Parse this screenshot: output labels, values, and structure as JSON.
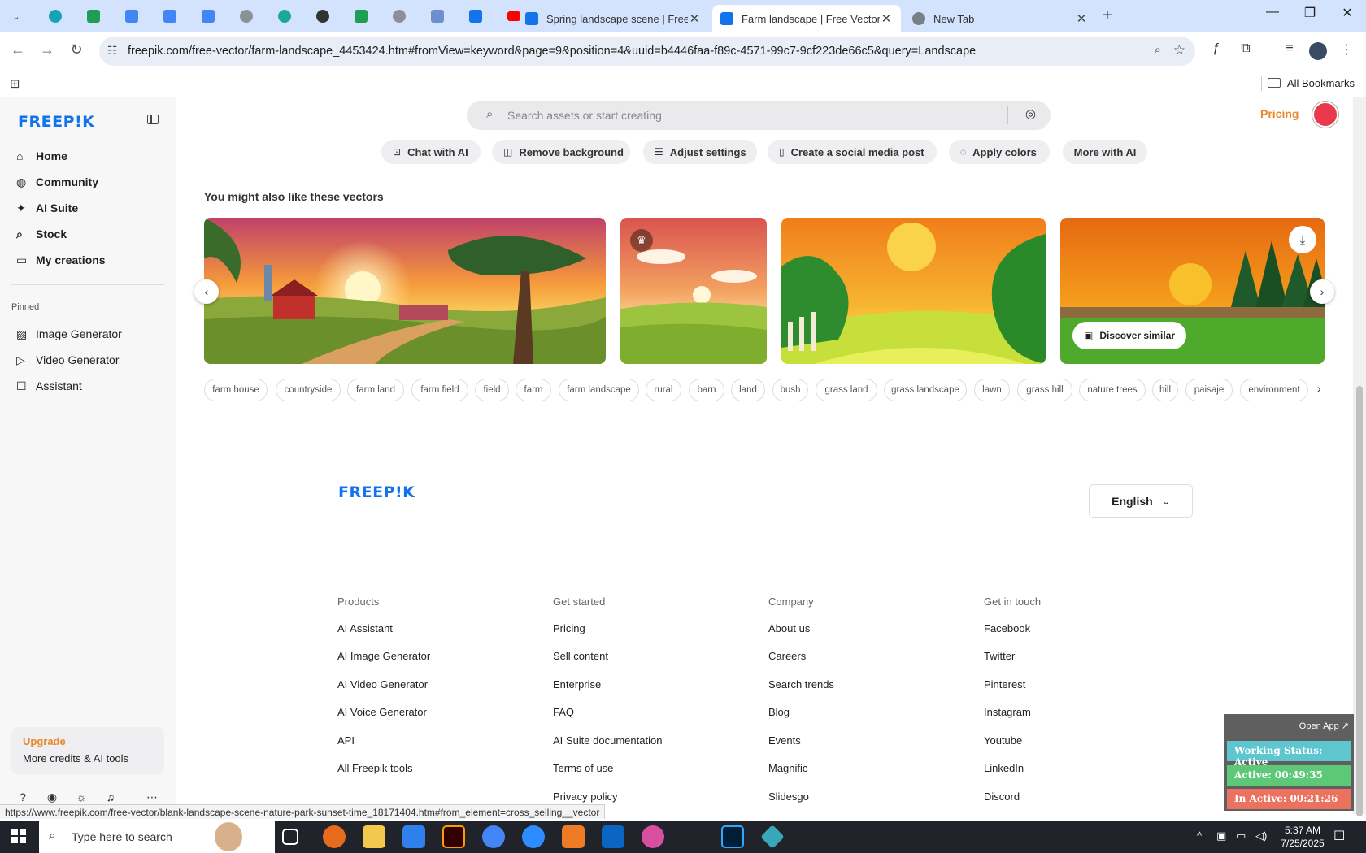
{
  "browser": {
    "tabs": [
      {
        "title": "Spring landscape scene | Free V",
        "favicon": "freepik-icon",
        "active": false
      },
      {
        "title": "Farm landscape | Free Vector",
        "favicon": "freepik-icon",
        "active": true
      },
      {
        "title": "New Tab",
        "favicon": "chrome-icon",
        "active": false
      }
    ],
    "url": "freepik.com/free-vector/farm-landscape_4453424.htm#fromView=keyword&page=9&position=4&uuid=b4446faa-f89c-4571-99c7-9cf223de66c5&query=Landscape",
    "bookmarks_label": "All Bookmarks",
    "status_url": "https://www.freepik.com/free-vector/blank-landscape-scene-nature-park-sunset-time_18171404.htm#from_element=cross_selling__vector"
  },
  "sidebar": {
    "logo": "FREEP!K",
    "nav": [
      {
        "label": "Home",
        "icon": "home-icon"
      },
      {
        "label": "Community",
        "icon": "globe-icon"
      },
      {
        "label": "AI Suite",
        "icon": "sparkle-icon"
      },
      {
        "label": "Stock",
        "icon": "search-icon"
      },
      {
        "label": "My creations",
        "icon": "folder-icon"
      }
    ],
    "pinned_label": "Pinned",
    "pinned": [
      {
        "label": "Image Generator",
        "icon": "image-icon"
      },
      {
        "label": "Video Generator",
        "icon": "video-icon"
      },
      {
        "label": "Assistant",
        "icon": "chat-icon"
      }
    ],
    "upgrade_title": "Upgrade",
    "upgrade_sub": "More credits & AI tools"
  },
  "header": {
    "search_placeholder": "Search assets or start creating",
    "pricing": "Pricing"
  },
  "ai_chips": [
    {
      "label": "Chat with AI",
      "icon": "chat-icon"
    },
    {
      "label": "Remove background",
      "icon": "eraser-icon"
    },
    {
      "label": "Adjust settings",
      "icon": "sliders-icon"
    },
    {
      "label": "Create a social media post",
      "icon": "phone-icon"
    },
    {
      "label": "Apply colors",
      "icon": "palette-icon"
    },
    {
      "label": "More with AI",
      "icon": ""
    }
  ],
  "related": {
    "title": "You might also like these vectors",
    "discover_label": "Discover similar"
  },
  "tags": [
    "farm house",
    "countryside",
    "farm land",
    "farm field",
    "field",
    "farm",
    "farm landscape",
    "rural",
    "barn",
    "land",
    "bush",
    "grass land",
    "grass landscape",
    "lawn",
    "grass hill",
    "nature trees",
    "hill",
    "paisaje",
    "environment"
  ],
  "footer": {
    "logo": "FREEP!K",
    "language": "English",
    "columns": [
      {
        "title": "Products",
        "links": [
          "AI Assistant",
          "AI Image Generator",
          "AI Video Generator",
          "AI Voice Generator",
          "API",
          "All Freepik tools"
        ]
      },
      {
        "title": "Get started",
        "links": [
          "Pricing",
          "Sell content",
          "Enterprise",
          "FAQ",
          "AI Suite documentation",
          "Terms of use",
          "Privacy policy"
        ]
      },
      {
        "title": "Company",
        "links": [
          "About us",
          "Careers",
          "Search trends",
          "Blog",
          "Events",
          "Magnific",
          "Slidesgo"
        ]
      },
      {
        "title": "Get in touch",
        "links": [
          "Facebook",
          "Twitter",
          "Pinterest",
          "Instagram",
          "Youtube",
          "LinkedIn",
          "Discord"
        ]
      }
    ]
  },
  "tracker": {
    "open_app": "Open App ↗",
    "working_status": "Working Status: Active",
    "active": "Active: 00:49:35",
    "inactive": "In Active: 00:21:26"
  },
  "taskbar": {
    "search_placeholder": "Type here to search",
    "time": "5:37 AM",
    "date": "7/25/2025"
  },
  "colors": {
    "brand_blue": "#1273eb",
    "accent_orange": "#e8872c",
    "tab_bar": "#d3e3fd"
  }
}
